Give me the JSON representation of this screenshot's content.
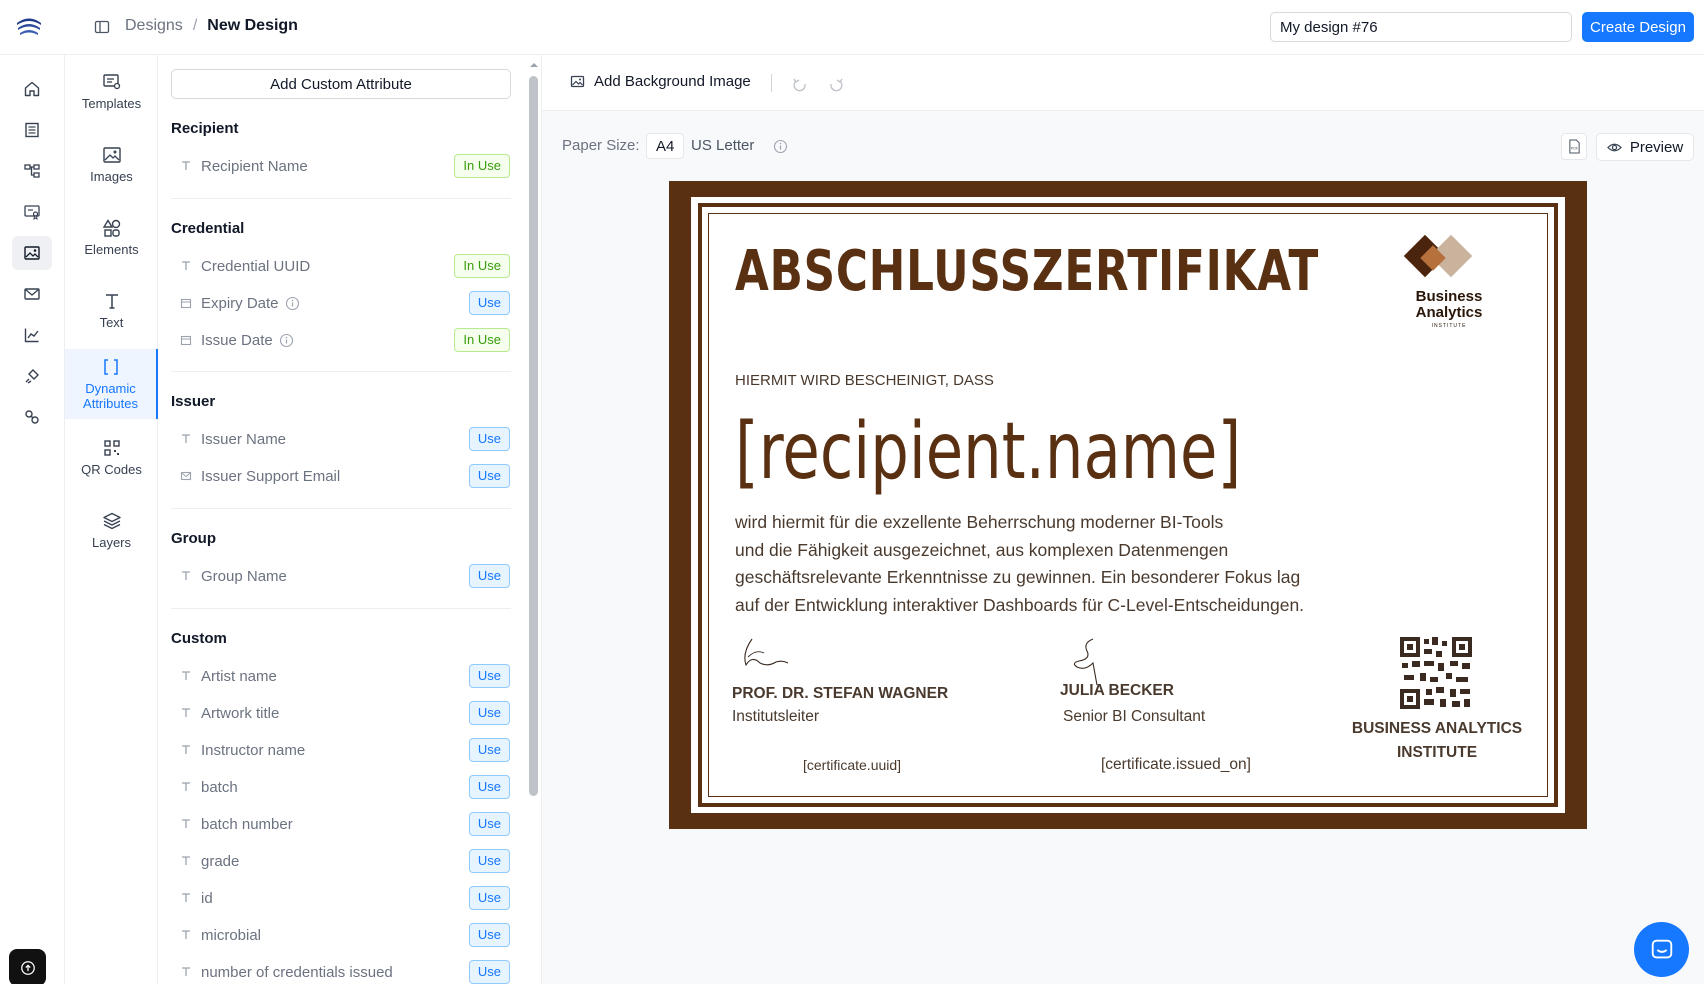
{
  "header": {
    "breadcrumb_root": "Designs",
    "breadcrumb_separator": "/",
    "breadcrumb_current": "New Design",
    "design_name_value": "My design #76",
    "create_button": "Create Design"
  },
  "rail": {
    "icons": [
      "home-icon",
      "catalog-icon",
      "workflow-icon",
      "certificate-icon",
      "image-design-icon",
      "mail-icon",
      "analytics-icon",
      "integrations-icon",
      "settings-link-icon"
    ]
  },
  "tools": {
    "templates": "Templates",
    "images": "Images",
    "elements": "Elements",
    "text": "Text",
    "dynamic_line1": "Dynamic",
    "dynamic_line2": "Attributes",
    "qr_codes": "QR Codes",
    "layers": "Layers"
  },
  "attributes": {
    "add_button": "Add Custom Attribute",
    "sections": {
      "recipient": "Recipient",
      "credential": "Credential",
      "issuer": "Issuer",
      "group": "Group",
      "custom": "Custom"
    },
    "badges": {
      "in_use": "In Use",
      "use": "Use"
    },
    "items": {
      "recipient_name": "Recipient Name",
      "credential_uuid": "Credential UUID",
      "expiry_date": "Expiry Date",
      "issue_date": "Issue Date",
      "issuer_name": "Issuer Name",
      "issuer_support_email": "Issuer Support Email",
      "group_name": "Group Name",
      "artist_name": "Artist name",
      "artwork_title": "Artwork title",
      "instructor_name": "Instructor name",
      "batch": "batch",
      "batch_number": "batch number",
      "grade": "grade",
      "id": "id",
      "microbial": "microbial",
      "number_of_credentials_issued": "number of credentials issued"
    }
  },
  "canvas": {
    "add_background": "Add Background Image",
    "paper_size_label": "Paper Size:",
    "paper_a4": "A4",
    "paper_letter": "US Letter",
    "pdf_icon_label": "PDF",
    "preview": "Preview"
  },
  "certificate": {
    "title": "ABSCHLUSSZERTIFIKAT",
    "subtitle": "HIERMIT WIRD BESCHEINIGT, DASS",
    "recipient": "[recipient.name]",
    "body_line1": "wird hiermit für die exzellente Beherrschung moderner BI-Tools",
    "body_line2": "und die Fähigkeit ausgezeichnet, aus komplexen Datenmengen",
    "body_line3": "geschäftsrelevante Erkenntnisse zu gewinnen. Ein besonderer Fokus lag",
    "body_line4": "auf der Entwicklung interaktiver Dashboards für C-Level-Entscheidungen.",
    "logo_line1": "Business",
    "logo_line2": "Analytics",
    "logo_line3": "INSTITUTE",
    "signer1_name": "PROF. DR. STEFAN WAGNER",
    "signer1_role": "Institutsleiter",
    "signer2_name": "JULIA BECKER",
    "signer2_role": "Senior BI Consultant",
    "uuid_field": "[certificate.uuid]",
    "issued_field": "[certificate.issued_on]",
    "inst_line1": "BUSINESS ANALYTICS",
    "inst_line2": "INSTITUTE"
  },
  "colors": {
    "accent": "#1677ff",
    "certificate_brown": "#5a3012",
    "in_use_green": "#389e0d"
  }
}
